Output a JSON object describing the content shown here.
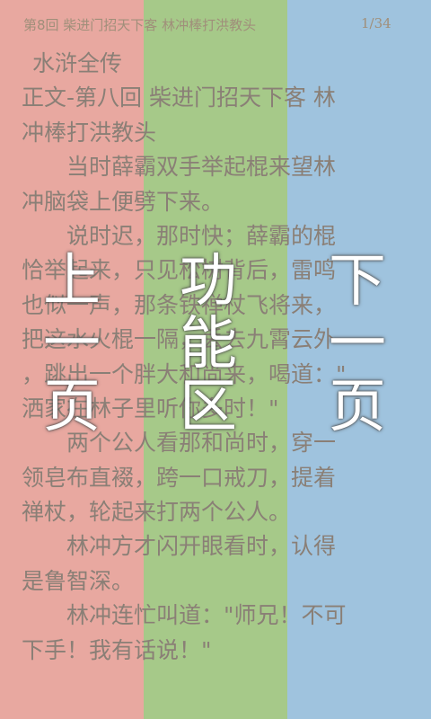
{
  "header": {
    "chapter_title": "第8回 柴进门招天下客 林冲棒打洪教头",
    "page_indicator": "1/34"
  },
  "content": {
    "lines": [
      "水浒全传",
      "正文-第八回 柴进门招天下客 林",
      "冲棒打洪教头",
      "　　当时薛霸双手举起棍来望林",
      "冲脑袋上便劈下来。",
      "　　说时迟，那时快；薛霸的棍",
      "恰举起来，只见松树背后，雷鸣",
      "也似一声，那条铁禅杖飞将来，",
      "把这水火棍一隔，丢去九霄云外",
      "，跳出一个胖大和尚来，喝道：\"",
      "洒家在林子里听你多时！\"",
      "　　两个公人看那和尚时，穿一",
      "领皂布直裰，跨一口戒刀，提着",
      "禅杖，轮起来打两个公人。",
      "　　林冲方才闪开眼看时，认得",
      "是鲁智深。",
      "　　林冲连忙叫道：\"师兄！不可",
      "下手！我有话说！\""
    ]
  },
  "zones": {
    "prev_page": {
      "chars": [
        "上",
        "一",
        "页"
      ],
      "color": "#e8a8a0"
    },
    "function_area": {
      "chars": [
        "功",
        "能",
        "区"
      ],
      "color": "#a6c989"
    },
    "next_page": {
      "chars": [
        "下",
        "一",
        "页"
      ],
      "color": "#9fc3de"
    }
  }
}
